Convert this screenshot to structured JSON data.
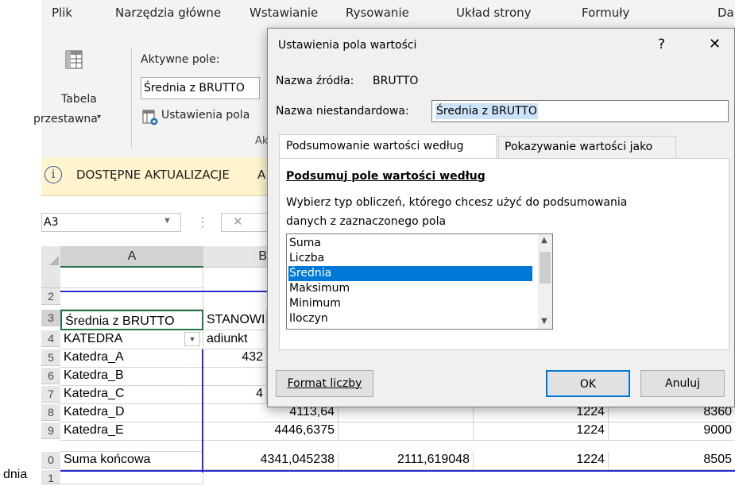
{
  "ribbon": {
    "tabs": [
      "Plik",
      "Narzędzia główne",
      "Wstawianie",
      "Rysowanie",
      "Układ strony",
      "Formuły",
      "Da"
    ],
    "pivot_table_label_line1": "Tabela",
    "pivot_table_label_line2": "przestawna",
    "active_field_label": "Aktywne pole:",
    "active_field_value": "Średnia z BRUTTO",
    "field_settings_label": "Ustawienia pola",
    "group_label": "Ak"
  },
  "infobar": {
    "icon": "i",
    "text": "DOSTĘPNE AKTUALIZACJE",
    "text_tail": "A"
  },
  "formula_bar": {
    "name_box": "A3",
    "cancel_glyph": "✕"
  },
  "grid": {
    "col_a_header": "A",
    "col_b_header": "B",
    "row_numbers": [
      "2",
      "3",
      "4",
      "5",
      "6",
      "7",
      "8",
      "9",
      "0",
      "1"
    ],
    "a3": "Średnia z BRUTTO",
    "b3": "STANOWISKO",
    "a4": "KATEDRA",
    "b4": "adiunkt",
    "rows": [
      {
        "a": "Katedra_A",
        "b": "432"
      },
      {
        "a": "Katedra_B",
        "b": ""
      },
      {
        "a": "Katedra_C",
        "b": "4"
      },
      {
        "a": "Katedra_D",
        "b": "4113,64",
        "d": "1224",
        "e": "8360"
      },
      {
        "a": "Katedra_E",
        "b": "4446,6375",
        "d": "1224",
        "e": "9000"
      },
      {
        "a": "Suma końcowa",
        "b": "4341,045238",
        "c": "2111,619048",
        "d": "1224",
        "e": "8505"
      }
    ],
    "side_text": "dnia"
  },
  "dialog": {
    "title": "Ustawienia pola wartości",
    "help": "?",
    "close": "✕",
    "source_label": "Nazwa źródła:",
    "source_value": "BRUTTO",
    "custom_name_label": "Nazwa niestandardowa:",
    "custom_name_value": "Średnia z BRUTTO",
    "tabs": [
      "Podsumowanie wartości według",
      "Pokazywanie wartości jako"
    ],
    "section_title": "Podsumuj pole wartości według",
    "description_line1": "Wybierz typ obliczeń, którego chcesz użyć do podsumowania",
    "description_line2": "danych z zaznaczonego pola",
    "functions": [
      "Suma",
      "Liczba",
      "Średnia",
      "Maksimum",
      "Minimum",
      "Iloczyn"
    ],
    "selected_function": "Średnia",
    "number_format_button": "Format liczby",
    "ok_button": "OK",
    "cancel_button": "Anuluj"
  }
}
